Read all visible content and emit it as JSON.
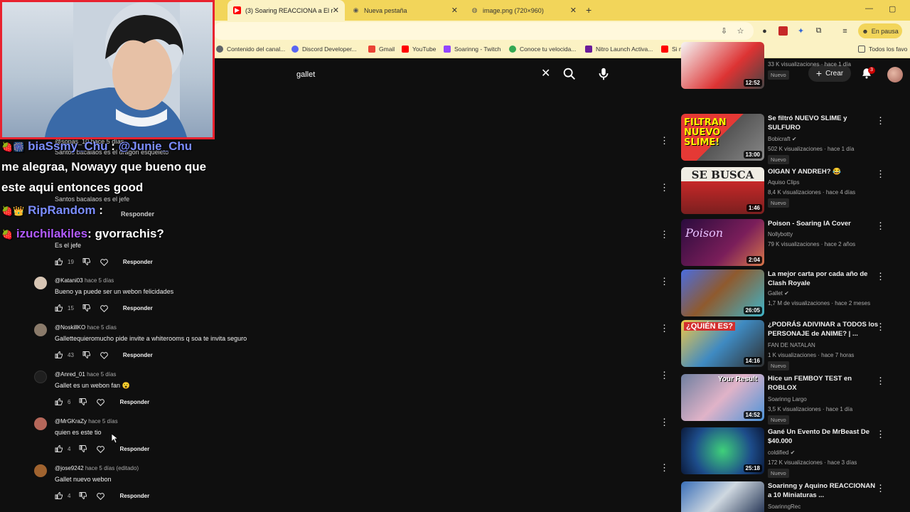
{
  "browser": {
    "tabs": [
      {
        "title": "(3) Soaring REACCIONA a El r",
        "active": true
      },
      {
        "title": "Nueva pestaña",
        "active": false
      },
      {
        "title": "image.png (720×960)",
        "active": false
      }
    ],
    "pause_label": "En pausa",
    "bookmarks": [
      "Contenido del canal...",
      "Discord Developer...",
      "Gmail",
      "YouTube",
      "Soarinng - Twitch",
      "Conoce tu velocida...",
      "Nitro Launch Activa...",
      "Si me Rio, Compro...",
      "Todos los favo"
    ]
  },
  "youtube": {
    "search_query": "gallet",
    "create_label": "Crear",
    "notification_count": "3"
  },
  "chat_overlay": {
    "line1_name": "biaSsmy_Chu",
    "line1_sep": " : ",
    "line1_mention": "@Junie_Chu",
    "line2": "me alegraa, Nowayy que bueno que",
    "line3": "este aqui entonces good",
    "line4_name": "RipRandom",
    "line4_sep": " : ",
    "line5_name": "izuchilakiles",
    "line5_text": ": gvorrachis?"
  },
  "underlay_text": {
    "u1": "@sopas_10 hace 5 días",
    "u2": "Santos bacalaos es el dragon esqueleto",
    "u3": "Santos bacalaos es el jefe",
    "u4": "Responder"
  },
  "comments": [
    {
      "author": "",
      "time": "",
      "text": "Es el jefe",
      "likes": "19",
      "reply": "Responder"
    },
    {
      "author": "@Katani03",
      "time": "hace 5 días",
      "text": "Bueno ya puede ser un webon felicidades",
      "likes": "15",
      "reply": "Responder"
    },
    {
      "author": "@NoskillKO",
      "time": "hace 5 días",
      "text": "Gallettequieromucho pide invite a whiterooms q soa te invita seguro",
      "likes": "43",
      "reply": "Responder"
    },
    {
      "author": "@Anred_01",
      "time": "hace 5 días",
      "text": "Gallet es un webon fan 😮",
      "likes": "6",
      "reply": "Responder"
    },
    {
      "author": "@MrGKraZy",
      "time": "hace 5 días",
      "text": "quien es este tio",
      "likes": "4",
      "reply": "Responder"
    },
    {
      "author": "@jose9242",
      "time": "hace 5 días (editado)",
      "text": "Gallet nuevo webon",
      "likes": "4",
      "reply": "Responder"
    }
  ],
  "related": [
    {
      "title": "",
      "channel": "",
      "meta": "33 K visualizaciones · hace 1 día",
      "badge": "Nuevo",
      "duration": "12:52"
    },
    {
      "title": "Se filtró NUEVO SLIME y SULFURO",
      "channel": "Bobicraft",
      "meta": "502 K visualizaciones · hace 1 día",
      "badge": "Nuevo",
      "duration": "13:00",
      "thumb_text": "FILTRAN NUEVO SLIME!"
    },
    {
      "title": "OIGAN Y ANDREH? 😂",
      "channel": "Aquiso Clips",
      "meta": "8,4 K visualizaciones · hace 4 días",
      "badge": "Nuevo",
      "duration": "1:46",
      "thumb_text": "SE BUSCA"
    },
    {
      "title": "Poison - Soaring IA Cover",
      "channel": "Nollybotty",
      "meta": "79 K visualizaciones · hace 2 años",
      "badge": "",
      "duration": "2:04",
      "thumb_text": "Poison"
    },
    {
      "title": "La mejor carta por cada año de Clash Royale",
      "channel": "Gallet",
      "meta": "1,7 M de visualizaciones · hace 2 meses",
      "badge": "",
      "duration": "26:05"
    },
    {
      "title": "¿PODRÁS ADIVINAR a TODOS los PERSONAJE de ANIME? | ...",
      "channel": "FAN DE NATALAN",
      "meta": "1 K visualizaciones · hace 7 horas",
      "badge": "Nuevo",
      "duration": "14:16",
      "thumb_text": "¿QUIÉN ES?"
    },
    {
      "title": "Hice un FEMBOY TEST en ROBLOX",
      "channel": "Soarinng Largo",
      "meta": "3,5 K visualizaciones · hace 1 día",
      "badge": "Nuevo",
      "duration": "14:52",
      "thumb_text": "Your Result"
    },
    {
      "title": "Gané Un Evento De MrBeast De $40.000",
      "channel": "coldified",
      "meta": "172 K visualizaciones · hace 3 días",
      "badge": "Nuevo",
      "duration": "25:18"
    },
    {
      "title": "Soarinng y Aquino REACCIONAN a 10 Miniaturas ...",
      "channel": "SoarinngRec",
      "meta": "",
      "badge": "",
      "duration": ""
    }
  ],
  "colors": {
    "tab_bg": "#f2d55a",
    "toolbar_bg": "#fbf2c4",
    "yt_bg": "#0f0f0f",
    "webcam_border": "#e8222f"
  }
}
